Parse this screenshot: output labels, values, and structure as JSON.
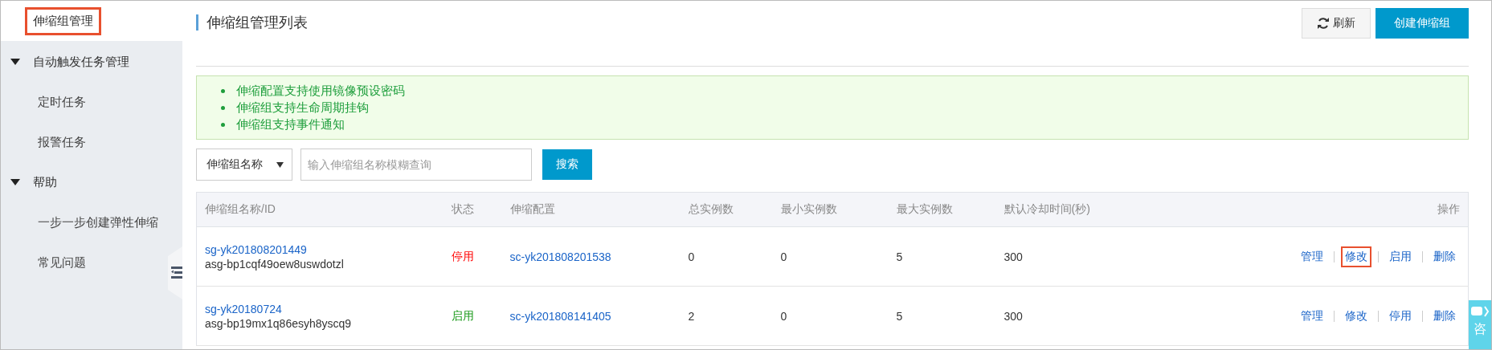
{
  "sidebar": {
    "top_item": {
      "label": "伸缩组管理",
      "highlighted": true
    },
    "groups": [
      {
        "label": "自动触发任务管理",
        "expanded": true,
        "children": [
          {
            "label": "定时任务"
          },
          {
            "label": "报警任务"
          }
        ]
      },
      {
        "label": "帮助",
        "expanded": true,
        "children": [
          {
            "label": "一步一步创建弹性伸缩"
          },
          {
            "label": "常见问题"
          }
        ]
      }
    ]
  },
  "header": {
    "title": "伸缩组管理列表",
    "buttons": [
      {
        "label": "刷新",
        "kind": "refresh"
      },
      {
        "label": "创建伸缩组",
        "kind": "primary"
      }
    ]
  },
  "notice": {
    "items": [
      "伸缩配置支持使用镜像预设密码",
      "伸缩组支持生命周期挂钩",
      "伸缩组支持事件通知"
    ]
  },
  "search": {
    "filter": "伸缩组名称",
    "placeholder": "输入伸缩组名称模糊查询",
    "button": "搜索"
  },
  "table": {
    "columns": [
      "伸缩组名称/ID",
      "状态",
      "伸缩配置",
      "总实例数",
      "最小实例数",
      "最大实例数",
      "默认冷却时间(秒)",
      "操作"
    ],
    "rows": [
      {
        "name": "sg-yk201808201449",
        "id": "asg-bp1cqf49oew8uswdotzl",
        "status": "停用",
        "color": "#ff0000",
        "config": "sc-yk201808201538",
        "total": "0",
        "min": "0",
        "max": "5",
        "cooldown": "300",
        "actions": [
          {
            "label": "管理",
            "highlighted": false
          },
          {
            "label": "修改",
            "highlighted": true
          },
          {
            "label": "启用",
            "highlighted": false
          },
          {
            "label": "删除",
            "highlighted": false
          }
        ]
      },
      {
        "name": "sg-yk20180724",
        "id": "asg-bp19mx1q86esyh8yscq9",
        "status": "启用",
        "color": "#1a9a1a",
        "config": "sc-yk201808141405",
        "total": "2",
        "min": "0",
        "max": "5",
        "cooldown": "300",
        "actions": [
          {
            "label": "管理",
            "highlighted": false
          },
          {
            "label": "修改",
            "highlighted": false
          },
          {
            "label": "停用",
            "highlighted": false
          },
          {
            "label": "删除",
            "highlighted": false
          }
        ]
      }
    ]
  },
  "consult": {
    "label": "咨"
  }
}
